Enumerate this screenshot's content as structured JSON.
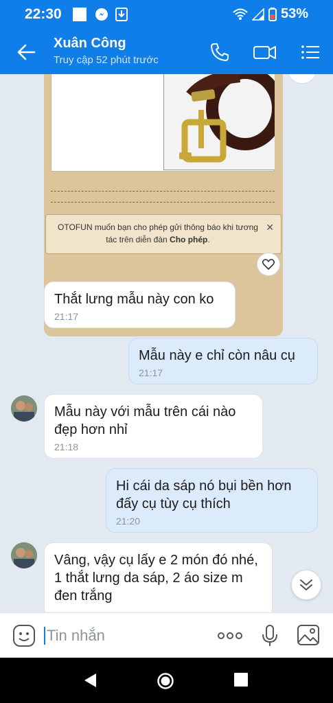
{
  "status_bar": {
    "time": "22:30",
    "battery": "53%"
  },
  "header": {
    "name": "Xuân Công",
    "status": "Truy cập 52 phút trước"
  },
  "card": {
    "notice_text": "OTOFUN muốn bạn cho phép gửi thông báo khi tương tác trên diễn đàn ",
    "notice_bold": "Cho phép",
    "notice_end": ".",
    "close": "✕"
  },
  "messages": [
    {
      "text": "Thắt lưng mẫu này con ko",
      "time": "21:17",
      "dir": "in"
    },
    {
      "text": "Mẫu này e chỉ còn nâu cụ",
      "time": "21:17",
      "dir": "out"
    },
    {
      "text": "Mẫu này với mẫu trên cái nào\nđẹp hơn nhỉ",
      "time": "21:18",
      "dir": "in"
    },
    {
      "text": "Hi cái da sáp nó bụi bền hơn\nđấy cụ tùy cụ thích",
      "time": "21:20",
      "dir": "out"
    },
    {
      "text": "Vâng, vậy cụ lấy e 2 món đó nhé,\n1 thắt lưng da sáp, 2 áo size m\nđen trắng",
      "time": "",
      "dir": "in"
    }
  ],
  "composer": {
    "placeholder": "Tin nhắn"
  },
  "colors": {
    "brand": "#0f7ee8",
    "out_bubble": "#dcebfc",
    "chat_bg": "#e2e9f1"
  }
}
